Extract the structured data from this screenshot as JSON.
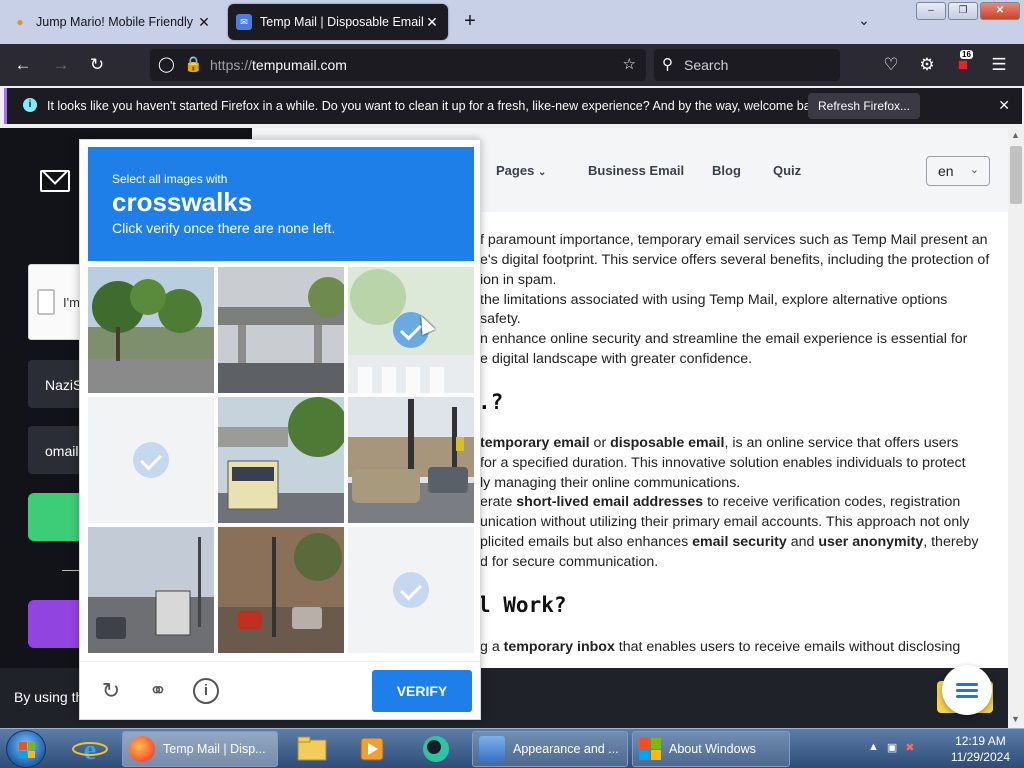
{
  "browser": {
    "tabs": [
      {
        "title": "Jump Mario! Mobile Friendly G",
        "active": false
      },
      {
        "title": "Temp Mail | Disposable Email A",
        "active": true
      }
    ],
    "url_protocol": "https://",
    "url_host": "tempumail.com",
    "search_placeholder": "Search",
    "extension_badge": "16"
  },
  "notification": {
    "message": "It looks like you haven't started Firefox in a while. Do you want to clean it up for a fresh, like-new experience? And by the way, welcome back!",
    "button": "Refresh Firefox..."
  },
  "site": {
    "nav": [
      "Pages",
      "Business Email",
      "Blog",
      "Quiz"
    ],
    "language": "en",
    "left_fields": [
      "NaziS",
      "omail"
    ],
    "captcha_label": "I'm",
    "article_lines": [
      "f paramount importance, temporary email services such as Temp Mail present an",
      "e's digital footprint. This service offers several benefits, including the protection of",
      "ion in spam.",
      "the limitations associated with using Temp Mail, explore alternative options",
      "safety.",
      "n enhance online security and streamline the email experience is essential for",
      "e digital landscape with greater confidence."
    ],
    "heading1": ".?",
    "para2": [
      {
        "pre": "",
        "b1": "temporary email",
        "mid": " or ",
        "b2": "disposable email",
        "post": ", is an online service that offers users"
      },
      {
        "pre": "for a specified duration. This innovative solution enables individuals to protect",
        "b1": "",
        "mid": "",
        "b2": "",
        "post": ""
      },
      {
        "pre": "ly managing their online communications.",
        "b1": "",
        "mid": "",
        "b2": "",
        "post": ""
      },
      {
        "pre": "erate ",
        "b1": "short-lived email addresses",
        "mid": " to receive verification codes, registration",
        "b2": "",
        "post": ""
      },
      {
        "pre": "unication without utilizing their primary email accounts. This approach not only",
        "b1": "",
        "mid": "",
        "b2": "",
        "post": ""
      },
      {
        "pre": "plicited emails but also enhances ",
        "b1": "email security",
        "mid": " and ",
        "b2": "user anonymity",
        "post": ", thereby"
      },
      {
        "pre": "d for secure communication.",
        "b1": "",
        "mid": "",
        "b2": "",
        "post": ""
      }
    ],
    "heading2": "l Work?",
    "para3_pre": "g a ",
    "para3_bold": "temporary inbox",
    "para3_post": " that enables users to receive emails without disclosing",
    "cookie_text": "By using th"
  },
  "captcha": {
    "instruction": "Select all images with",
    "target": "crosswalks",
    "subtext": "Click verify once there are none left.",
    "verify_label": "VERIFY",
    "tiles_selected": [
      false,
      false,
      true,
      true,
      false,
      false,
      false,
      false,
      true
    ]
  },
  "taskbar": {
    "tasks": [
      {
        "label": "Temp Mail | Disp...",
        "active": true
      },
      {
        "label": "Appearance and ...",
        "active": false
      },
      {
        "label": "About Windows",
        "active": false
      }
    ],
    "time": "12:19 AM",
    "date": "11/29/2024"
  },
  "colors": {
    "captcha_blue": "#1f7fe8",
    "green_button": "#3dcc78",
    "purple_button": "#9144e0",
    "firefox_dark": "#2b2a33"
  }
}
